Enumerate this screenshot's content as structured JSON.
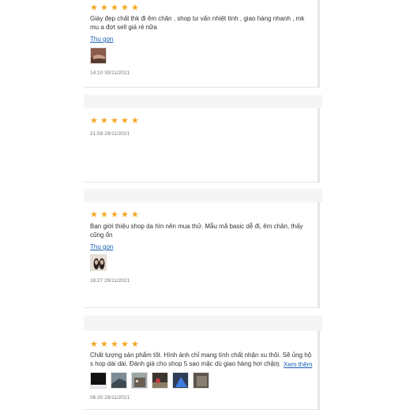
{
  "reviews": [
    {
      "rating": 5,
      "text": "Giày đẹp chất thk đi êm chân , shop tư vấn nhiệt tình , giao hàng nhanh , mk mu a đợt sell giá rẻ nữa",
      "toggle": "Thu gọn",
      "time": "14:10 30/11/2021",
      "thumbs": [
        "shoe-photo"
      ]
    },
    {
      "rating": 5,
      "time": "21:59 29/11/2021"
    },
    {
      "rating": 5,
      "text": "Bạn giới thiệu shop da hìn nên mua thử. Mẫu mã basic dễ đi, êm chân, thấy cũng ổn",
      "toggle": "Thu gọn",
      "time": "18:27 29/11/2021",
      "thumbs": [
        "shoe-photo"
      ]
    },
    {
      "rating": 5,
      "text": "Chất lượng sản phẩm tốt. Hình ảnh chỉ mang tính chất nhận xu thôi. Sẽ ủng hộ s hop dài dài. Đánh giá cho shop 5 sao mặc dù giao hàng hơi chậm",
      "more_dots": "...",
      "more": "Xem thêm",
      "time": "06:30 29/11/2021",
      "thumbs": [
        "dark-photo",
        "house-photo",
        "building-photo",
        "yard-photo",
        "tent-photo",
        "room-photo"
      ]
    }
  ],
  "colors": {
    "star": "#f5a623",
    "link": "#1a5fb4",
    "band": "#f5f5f5"
  }
}
